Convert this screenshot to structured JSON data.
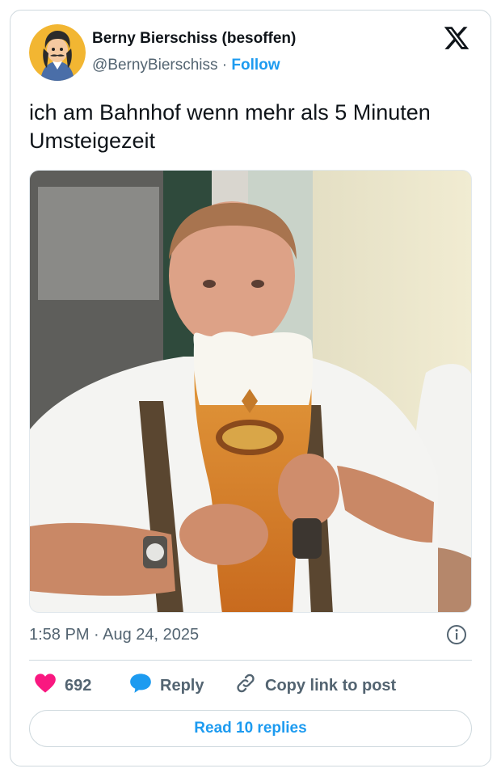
{
  "author": {
    "name": "Berny Bierschiss (besoffen)",
    "handle": "@BernyBierschiss",
    "separator": "·",
    "follow_label": "Follow"
  },
  "tweet": {
    "text": "ich am Bahnhof wenn mehr als 5 Minuten Umsteigezeit",
    "timestamp": "1:58 PM · Aug 24, 2025"
  },
  "actions": {
    "like_count": "692",
    "reply_label": "Reply",
    "copy_label": "Copy link to post"
  },
  "footer": {
    "read_replies_label": "Read 10 replies"
  },
  "colors": {
    "accent": "#1d9bf0",
    "like": "#f91880",
    "muted": "#536471",
    "border": "#cfd9de"
  },
  "icons": [
    "x-logo-icon",
    "info-icon",
    "heart-icon",
    "reply-bubble-icon",
    "link-icon"
  ]
}
